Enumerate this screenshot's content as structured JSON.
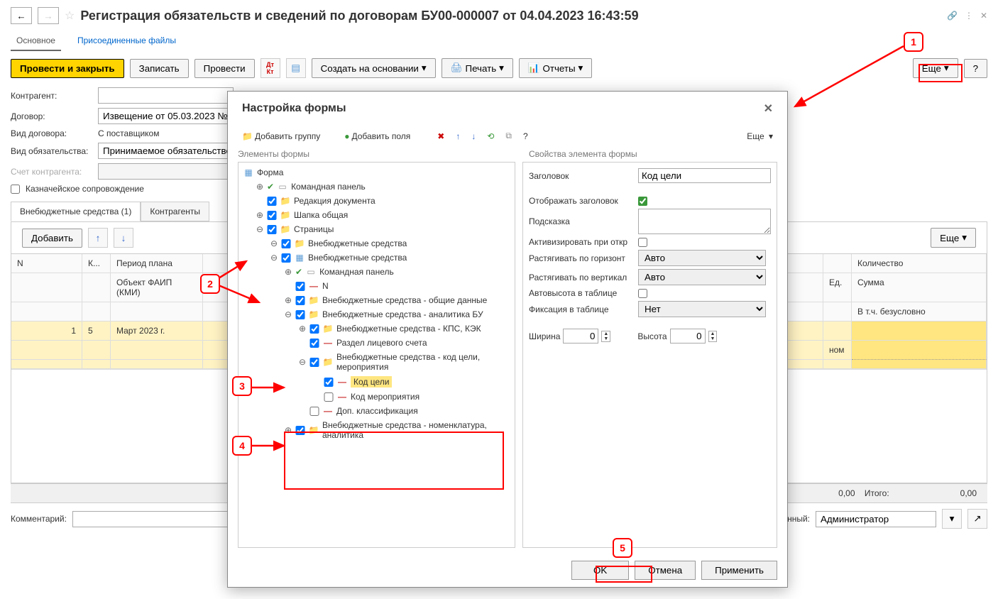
{
  "header": {
    "title": "Регистрация обязательств и сведений по договорам БУ00-000007 от 04.04.2023 16:43:59"
  },
  "nav_tabs": {
    "main": "Основное",
    "files": "Присоединенные файлы"
  },
  "toolbar": {
    "save_close": "Провести и закрыть",
    "save": "Записать",
    "post": "Провести",
    "create_based": "Создать на основании",
    "print": "Печать",
    "reports": "Отчеты",
    "more": "Еще",
    "help": "?"
  },
  "form": {
    "contragent_label": "Контрагент:",
    "contract_label": "Договор:",
    "contract_value": "Извещение от 05.03.2023 №",
    "contract_type_label": "Вид договора:",
    "contract_type_value": "С поставщиком",
    "obligation_type_label": "Вид обязательства:",
    "obligation_type_value": "Принимаемое обязательство",
    "account_label": "Счет контрагента:",
    "treasury_label": "Казначейское сопровождение"
  },
  "section_tabs": {
    "offbudget": "Внебюджетные средства (1)",
    "contragents": "Контрагенты"
  },
  "grid_toolbar": {
    "add": "Добавить",
    "more": "Еще"
  },
  "grid": {
    "col_n": "N",
    "col_k": "К...",
    "col_period": "Период плана",
    "col_faip": "Объект ФАИП (КМИ)",
    "col_ed": "Ед.",
    "col_qty": "Количество",
    "col_sum": "Сумма",
    "col_uncond": "В т.ч. безусловно",
    "row1_n": "1",
    "row1_k": "5",
    "row1_period": "Март 2023 г.",
    "row1_unit": "ном"
  },
  "summary": {
    "amount1": "0,00",
    "total_label": "Итого:",
    "total_value": "0,00"
  },
  "footer": {
    "comment_label": "Комментарий:",
    "resp_label": "ственный:",
    "resp_value": "Администратор"
  },
  "dialog": {
    "title": "Настройка формы",
    "add_group": "Добавить группу",
    "add_fields": "Добавить поля",
    "more": "Еще",
    "elements_header": "Элементы формы",
    "props_header": "Свойства элемента формы",
    "tree": {
      "form": "Форма",
      "cmd_panel": "Командная панель",
      "doc_edit": "Редакция документа",
      "header_common": "Шапка общая",
      "pages": "Страницы",
      "offbudget": "Внебюджетные средства",
      "offbudget_table": "Внебюджетные средства",
      "cmd_panel2": "Командная панель",
      "n_field": "N",
      "common_data": "Внебюджетные средства - общие данные",
      "analytics": "Внебюджетные средства - аналитика БУ",
      "kps": "Внебюджетные средства - КПС, КЭК",
      "account_section": "Раздел лицевого счета",
      "target_code_group": "Внебюджетные средства - код цели, мероприятия",
      "target_code": "Код цели",
      "event_code": "Код мероприятия",
      "addl_class": "Доп. классификация",
      "nomenclature": "Внебюджетные средства - номенклатура, аналитика"
    },
    "props": {
      "title_label": "Заголовок",
      "title_value": "Код цели",
      "show_title_label": "Отображать заголовок",
      "hint_label": "Подсказка",
      "activate_label": "Активизировать при откр",
      "stretch_h_label": "Растягивать по горизонт",
      "stretch_h_value": "Авто",
      "stretch_v_label": "Растягивать по вертикал",
      "stretch_v_value": "Авто",
      "autoheight_label": "Автовысота в таблице",
      "fixation_label": "Фиксация в таблице",
      "fixation_value": "Нет",
      "width_label": "Ширина",
      "width_value": "0",
      "height_label": "Высота",
      "height_value": "0"
    },
    "buttons": {
      "ok": "OK",
      "cancel": "Отмена",
      "apply": "Применить"
    }
  },
  "callouts": {
    "c1": "1",
    "c2": "2",
    "c3": "3",
    "c4": "4",
    "c5": "5"
  }
}
